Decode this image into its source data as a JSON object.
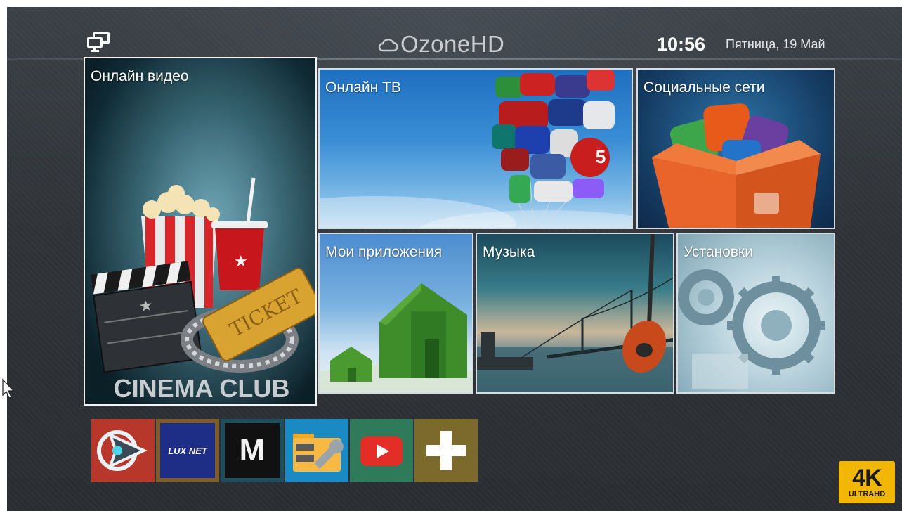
{
  "header": {
    "brand": "OzoneHD",
    "time": "10:56",
    "date": "Пятница, 19 Май"
  },
  "tiles": {
    "online_video": {
      "label": "Онлайн видео",
      "poster_text": "CINEMA CLUB",
      "ticket_text": "TICKET"
    },
    "online_tv": {
      "label": "Онлайн ТВ"
    },
    "social": {
      "label": "Социальные сети"
    },
    "my_apps": {
      "label": "Мои приложения"
    },
    "music": {
      "label": "Музыка"
    },
    "settings": {
      "label": "Установки"
    }
  },
  "apps": {
    "mx_letter": "M",
    "luxnet_text": "LUX NET"
  },
  "badge": {
    "main": "4K",
    "sub": "ULTRAHD"
  },
  "colors": {
    "accent_4k": "#f2b705",
    "youtube_red": "#e52d27"
  },
  "icons": [
    "network-icon",
    "cloud-icon",
    "play-icon",
    "wrench-icon",
    "plus-icon",
    "folder-icon",
    "cursor-icon"
  ]
}
